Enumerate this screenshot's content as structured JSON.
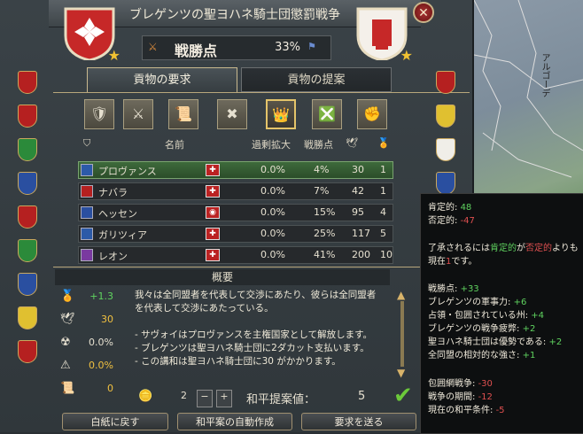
{
  "title": "ブレゲンツの聖ヨハネ騎士団懲罰戦争",
  "warscore": {
    "label": "戦勝点",
    "value": "33%"
  },
  "tabs": {
    "demand": "貢物の要求",
    "offer": "貢物の提案"
  },
  "table": {
    "headers": {
      "name": "名前",
      "overextension": "過剰拡大",
      "warscore": "戦勝点"
    },
    "rows": [
      {
        "name": "プロヴァンス",
        "overextension": "0.0%",
        "warscore": "4%",
        "val1": "30",
        "val2": "1"
      },
      {
        "name": "ナバラ",
        "overextension": "0.0%",
        "warscore": "7%",
        "val1": "42",
        "val2": "1"
      },
      {
        "name": "ヘッセン",
        "overextension": "0.0%",
        "warscore": "15%",
        "val1": "95",
        "val2": "4"
      },
      {
        "name": "ガリツィア",
        "overextension": "0.0%",
        "warscore": "25%",
        "val1": "117",
        "val2": "5"
      },
      {
        "name": "レオン",
        "overextension": "0.0%",
        "warscore": "41%",
        "val1": "200",
        "val2": "10"
      }
    ]
  },
  "summary": {
    "title": "概要",
    "stats": [
      "+1.3",
      "30",
      "0.0%",
      "0.0%",
      "0"
    ],
    "lines": [
      "我々は全同盟者を代表して交渉にあたり、彼らは全同盟者",
      "を代表して交渉にあたっている。",
      "",
      "- サヴォイはプロヴァンスを主権国家として解放します。",
      "- ブレゲンツは聖ヨハネ騎士団に2ダカット支払います。",
      "- この講和は聖ヨハネ騎士団に30 がかかります。"
    ]
  },
  "controls": {
    "amount": "2",
    "minus": "−",
    "plus": "+",
    "peace_label": "和平提案値：",
    "peace_value": "5"
  },
  "buttons": {
    "reset": "白紙に戻す",
    "auto": "和平案の自動作成",
    "send": "要求を送る"
  },
  "tooltip": {
    "pos_label": "肯定的: ",
    "pos_val": "48",
    "neg_label": "否定的: ",
    "neg_val": "-47",
    "line1a": "了承されるには",
    "line1b": "肯定的",
    "line1c": "が",
    "line1d": "否定的",
    "line1e": "よりも",
    "line2a": "現在",
    "line2b": "1",
    "line2c": "です。",
    "items": [
      {
        "label": "戦勝点: ",
        "val": "+33",
        "cls": "g"
      },
      {
        "label": "ブレゲンツの軍事力: ",
        "val": "+6",
        "cls": "g"
      },
      {
        "label": "占領・包囲されている州: ",
        "val": "+4",
        "cls": "g"
      },
      {
        "label": "ブレゲンツの戦争疲弊: ",
        "val": "+2",
        "cls": "g"
      },
      {
        "label": "聖ヨハネ騎士団は優勢である: ",
        "val": "+2",
        "cls": "g"
      },
      {
        "label": "全同盟の相対的な強さ: ",
        "val": "+1",
        "cls": "g"
      },
      {
        "label": "包囲網戦争: ",
        "val": "-30",
        "cls": "r"
      },
      {
        "label": "戦争の期間: ",
        "val": "-12",
        "cls": "r"
      },
      {
        "label": "現在の和平条件: ",
        "val": "-5",
        "cls": "r"
      }
    ]
  },
  "map_text": "アルゴーデ"
}
